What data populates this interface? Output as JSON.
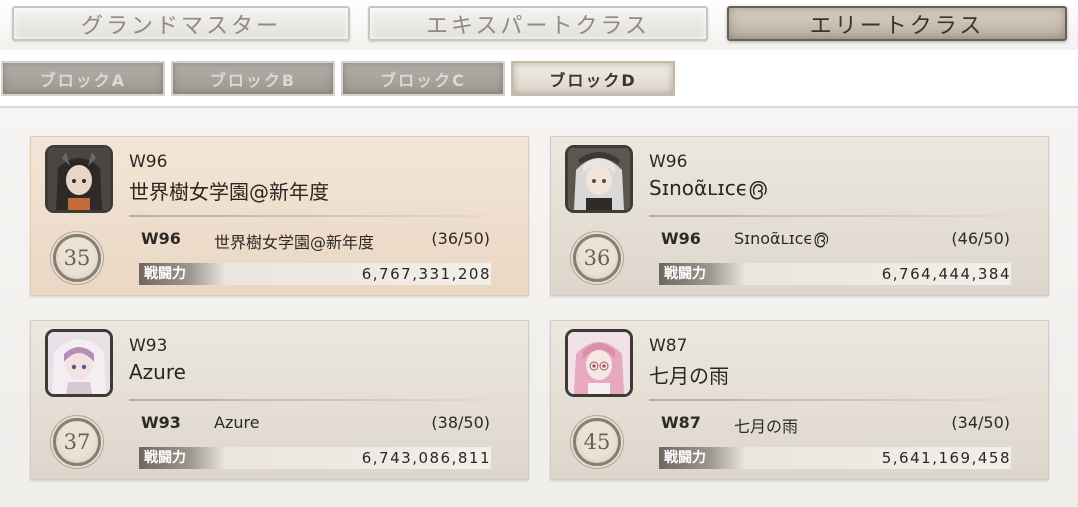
{
  "tabs": [
    {
      "label": "グランドマスター",
      "active": false
    },
    {
      "label": "エキスパートクラス",
      "active": false
    },
    {
      "label": "エリートクラス",
      "active": true
    }
  ],
  "blocks": [
    {
      "label": "ブロックA",
      "active": false
    },
    {
      "label": "ブロックB",
      "active": false
    },
    {
      "label": "ブロックC",
      "active": false
    },
    {
      "label": "ブロックD",
      "active": true
    }
  ],
  "entries": [
    {
      "rank": "35",
      "world": "W96",
      "name": "世界樹女学園@新年度",
      "members": "(36/50)",
      "power_label": "戦闘力",
      "power": "6,767,331,208",
      "avatar": "dark-haired-girl-portrait"
    },
    {
      "rank": "36",
      "world": "W96",
      "name": "Sɪnoᾶʟɪcϵ൫",
      "members": "(46/50)",
      "power_label": "戦闘力",
      "power": "6,764,444,384",
      "avatar": "white-haired-girl-portrait"
    },
    {
      "rank": "37",
      "world": "W93",
      "name": "Azure",
      "members": "(38/50)",
      "power_label": "戦闘力",
      "power": "6,743,086,811",
      "avatar": "hooded-girl-portrait"
    },
    {
      "rank": "45",
      "world": "W87",
      "name": "七月の雨",
      "members": "(34/50)",
      "power_label": "戦闘力",
      "power": "5,641,169,458",
      "avatar": "pink-haired-girl-portrait"
    }
  ]
}
